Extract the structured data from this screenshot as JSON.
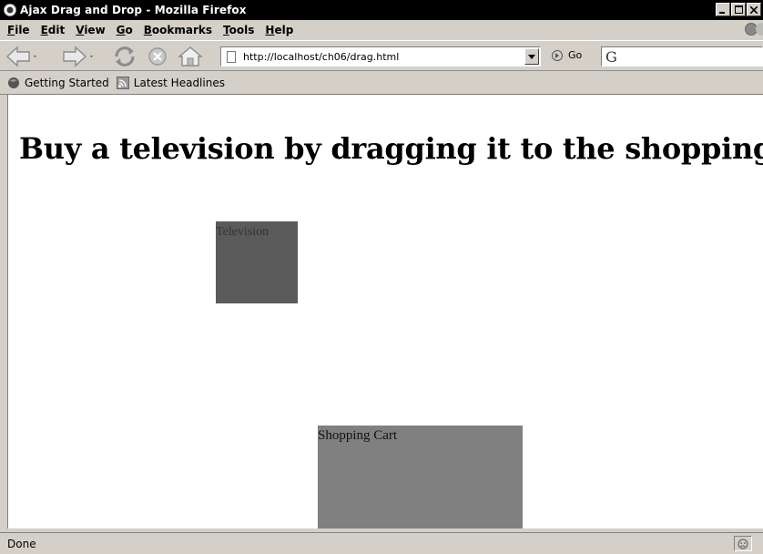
{
  "window": {
    "title": "Ajax Drag and Drop - Mozilla Firefox"
  },
  "menubar": {
    "items": [
      {
        "first": "F",
        "rest": "ile"
      },
      {
        "first": "E",
        "rest": "dit"
      },
      {
        "first": "V",
        "rest": "iew"
      },
      {
        "first": "G",
        "rest": "o"
      },
      {
        "first": "B",
        "rest": "ookmarks"
      },
      {
        "first": "T",
        "rest": "ools"
      },
      {
        "first": "H",
        "rest": "elp"
      }
    ]
  },
  "navbar": {
    "url": "http://localhost/ch06/drag.html",
    "go_label": "Go",
    "search_glyph": "G"
  },
  "bookmarks": {
    "items": [
      {
        "label": "Getting Started",
        "icon": "firefox-icon"
      },
      {
        "label": "Latest Headlines",
        "icon": "rss-feed-icon"
      }
    ]
  },
  "page": {
    "heading": "Buy a television by dragging it to the shopping cart",
    "draggable_label": "Television",
    "dropzone_label": "Shopping Cart",
    "colors": {
      "television": "#5a5a5a",
      "cart": "#808080"
    }
  },
  "statusbar": {
    "text": "Done"
  }
}
